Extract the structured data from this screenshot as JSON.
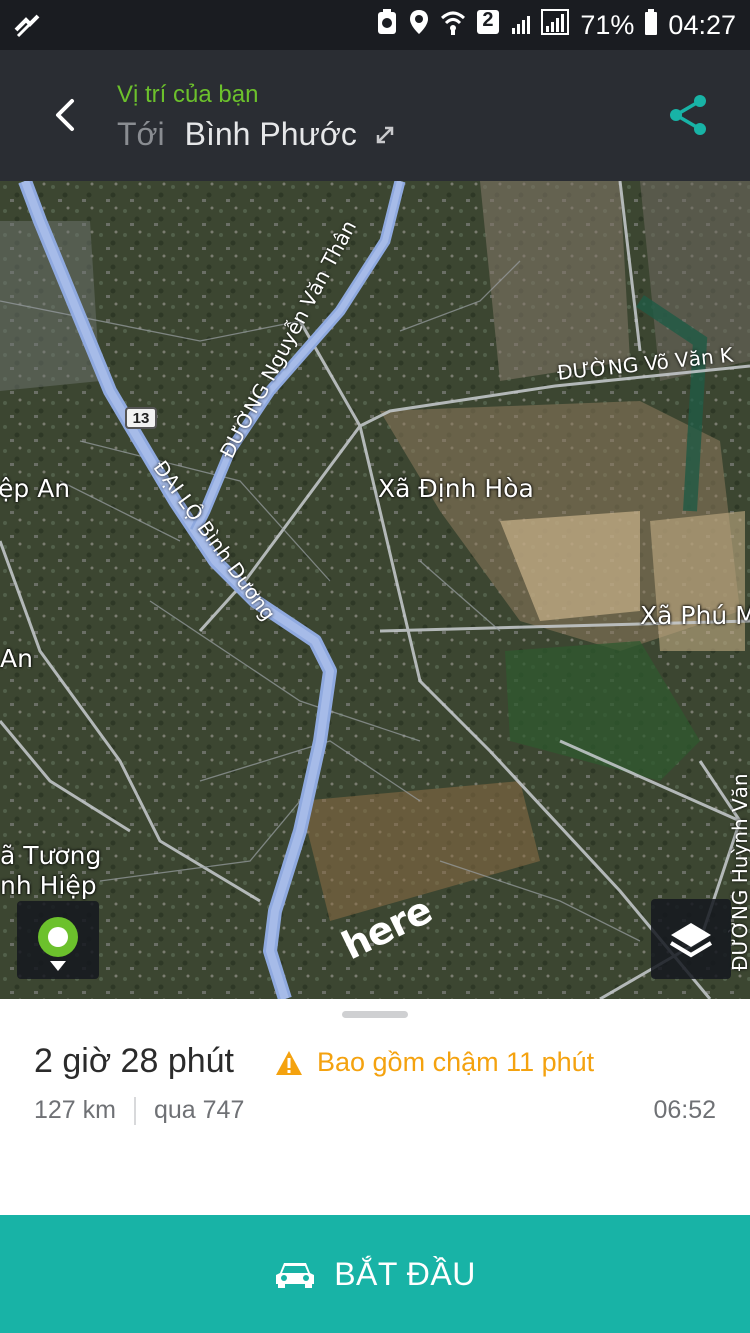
{
  "status_bar": {
    "sim_badge": "2",
    "battery": "71%",
    "time": "04:27",
    "icons": [
      "signal-off-icon",
      "sync-icon",
      "location-icon",
      "wifi-icon",
      "sim-icon",
      "cell-signal-icon",
      "battery-icon"
    ]
  },
  "header": {
    "origin": "Vị trí của bạn",
    "dest_prefix": "Tới",
    "destination": "Bình Phước",
    "accent": "#6cc12c",
    "share_color": "#18b3a6"
  },
  "map": {
    "labels": {
      "dinh_hoa": "Xã Định Hòa",
      "phu": "Xã Phú M",
      "hiep_an": "ệp An",
      "an": "An",
      "tuong": "ã Tương",
      "binh_hiep": "nh Hiệp",
      "nguyen_van_than": "ĐƯỜNG Nguyễn Văn Thân",
      "binh_duong": "ĐẠI LỘ Bình Dương",
      "vo_van": "ĐƯỜNG Võ Văn K",
      "huynh_van": "ĐƯỜNG Huỳnh Văn"
    },
    "shield": "13",
    "logo": "here"
  },
  "route": {
    "duration": "2 giờ 28 phút",
    "delay": "Bao gồm chậm 11 phút",
    "distance": "127 km",
    "via": "qua 747",
    "arrival": "06:52",
    "warning_color": "#f4a20f"
  },
  "start_button": {
    "label": "BẮT ĐẦU",
    "color": "#18b3a6"
  }
}
